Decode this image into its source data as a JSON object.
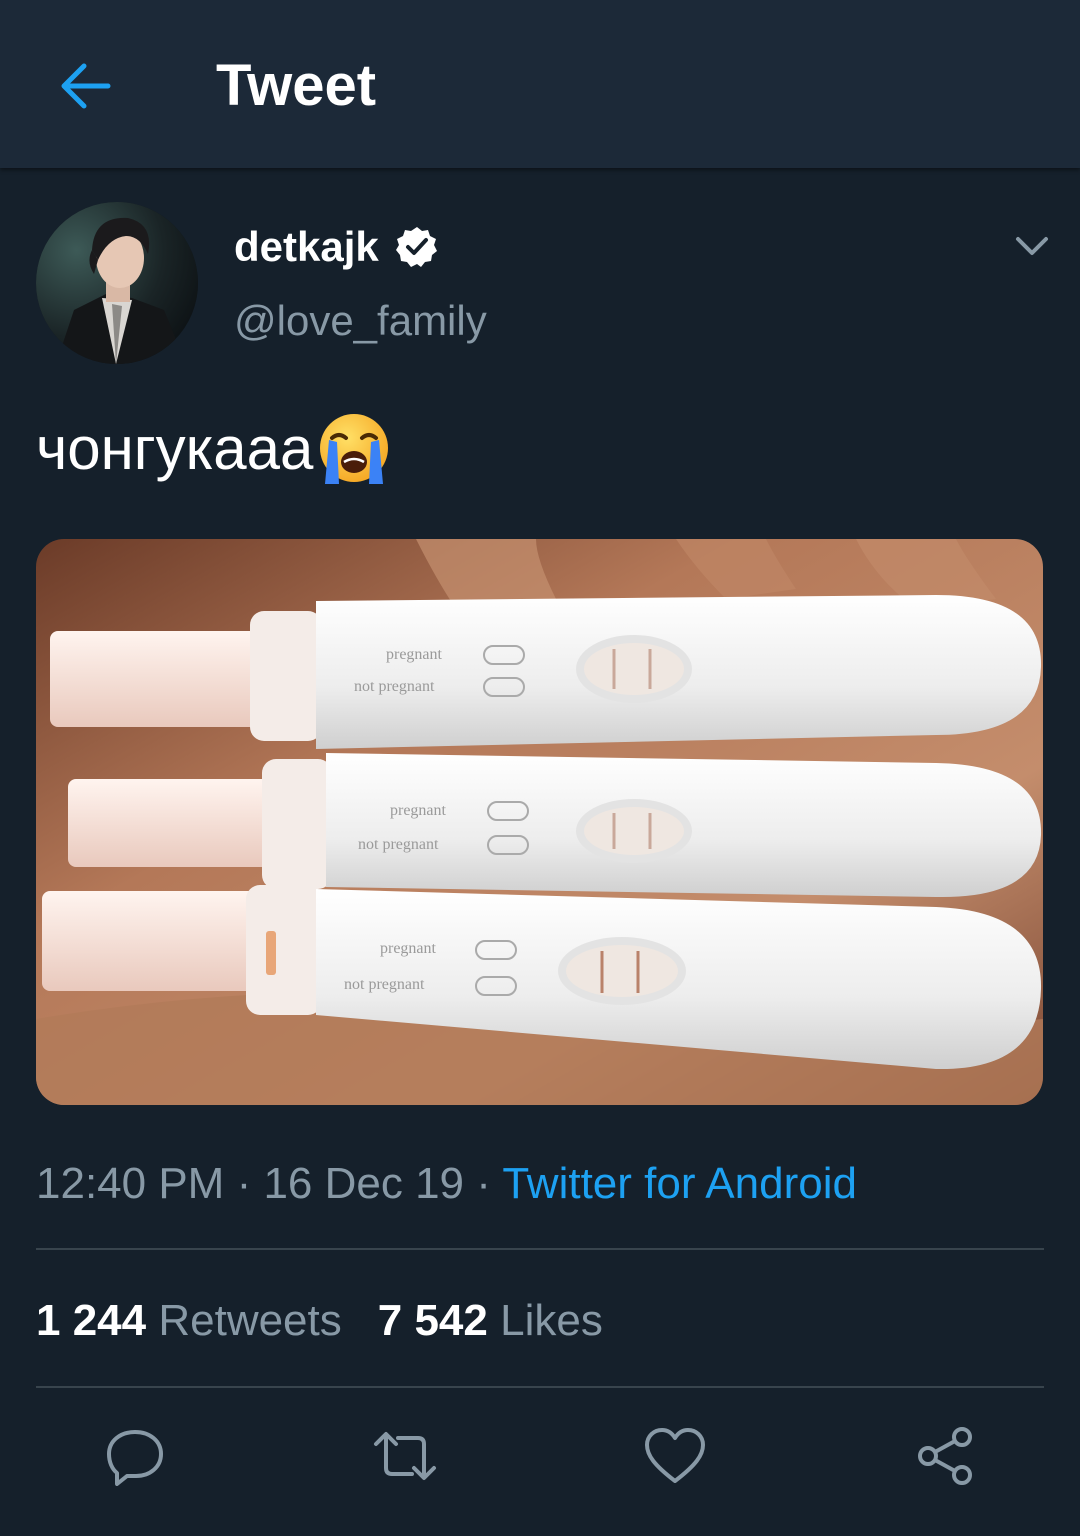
{
  "header": {
    "title": "Tweet",
    "back_icon": "arrow-left-icon"
  },
  "tweet": {
    "author": {
      "display_name": "detkajk",
      "verified": true,
      "handle": "@love_family"
    },
    "text": "чонгукааа",
    "emoji": "😭",
    "meta": {
      "time": "12:40 PM",
      "separator": " · ",
      "date": "16 Dec 19",
      "source": "Twitter for Android"
    },
    "stats": {
      "retweets_count": "1 244",
      "retweets_label": "Retweets",
      "likes_count": "7 542",
      "likes_label": "Likes"
    },
    "media": {
      "test_labels": [
        "pregnant",
        "not pregnant"
      ]
    }
  },
  "actions": [
    "reply-icon",
    "retweet-icon",
    "like-icon",
    "share-icon"
  ],
  "colors": {
    "background": "#15202b",
    "header": "#1c2938",
    "accent": "#1da1f2",
    "secondary_text": "#8899a6",
    "divider": "#38444d"
  }
}
